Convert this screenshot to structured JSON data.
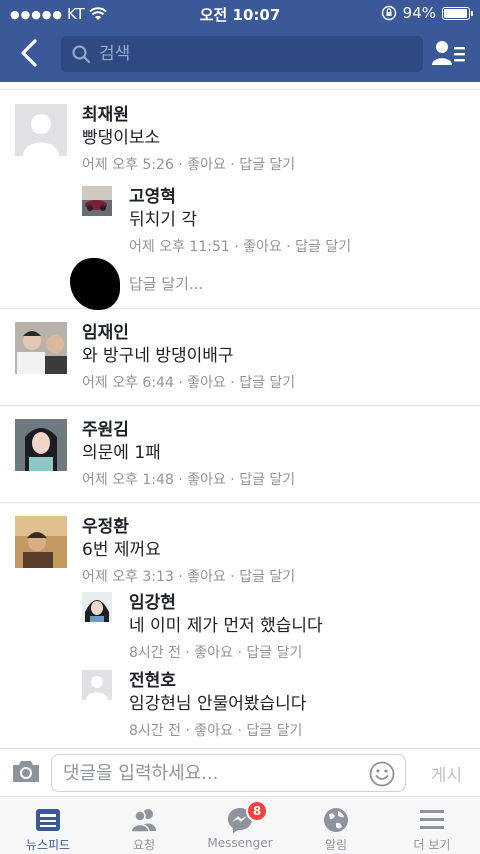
{
  "status_bar": {
    "carrier": "KT",
    "time": "오전 10:07",
    "battery": "94%"
  },
  "header": {
    "search_placeholder": "검색",
    "back_icon": "chevron-left-icon",
    "friends_icon": "friend-list-icon",
    "background": "#3b5998"
  },
  "comments": [
    {
      "name": "최재원",
      "text": "빵댕이보소",
      "time": "어제 오후 5:26",
      "like": "좋아요",
      "reply": "답글 달기",
      "replies": [
        {
          "name": "고영혁",
          "text": "뒤치기 각",
          "time": "어제 오후 11:51",
          "like": "좋아요",
          "reply": "답글 달기"
        }
      ],
      "reply_prompt": "답글 달기..."
    },
    {
      "name": "임재인",
      "text": "와 방구네 방댕이배구",
      "time": "어제 오후 6:44",
      "like": "좋아요",
      "reply": "답글 달기",
      "replies": []
    },
    {
      "name": "주원김",
      "text": "의문에 1패",
      "time": "어제 오후 1:48",
      "like": "좋아요",
      "reply": "답글 달기",
      "replies": []
    },
    {
      "name": "우정환",
      "text": "6번 제꺼요",
      "time": "어제 오후 3:13",
      "like": "좋아요",
      "reply": "답글 달기",
      "replies": [
        {
          "name": "임강현",
          "text": "네 이미 제가 먼저 했습니다",
          "time": "8시간 전",
          "like": "좋아요",
          "reply": "답글 달기"
        },
        {
          "name": "전현호",
          "text": "임강현님 안물어봤습니다",
          "time": "8시간 전",
          "like": "좋아요",
          "reply": "답글 달기"
        }
      ]
    }
  ],
  "compose": {
    "placeholder": "댓글을 입력하세요...",
    "post_label": "게시",
    "camera_icon": "camera-icon",
    "emoji_icon": "smiley-icon"
  },
  "tabs": [
    {
      "label": "뉴스피드",
      "icon": "news-feed-icon",
      "active": true
    },
    {
      "label": "요청",
      "icon": "friend-requests-icon"
    },
    {
      "label": "Messenger",
      "icon": "messenger-icon",
      "badge": "8"
    },
    {
      "label": "알림",
      "icon": "globe-icon"
    },
    {
      "label": "더 보기",
      "icon": "menu-icon"
    }
  ],
  "colors": {
    "brand": "#3b5998",
    "meta_text": "#90949c",
    "badge": "#fa3e3e"
  }
}
